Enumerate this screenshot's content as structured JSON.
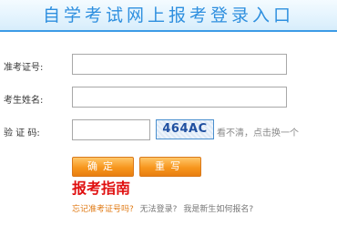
{
  "header": {
    "title": "自学考试网上报考登录入口"
  },
  "form": {
    "id_label": "准考证号:",
    "name_label": "考生姓名:",
    "captcha_label": "验 证 码:",
    "id_value": "",
    "name_value": "",
    "captcha_value": "",
    "captcha_code": "464AC",
    "captcha_hint": "看不清，点击换一个"
  },
  "buttons": {
    "confirm": "确定",
    "fill": "重写"
  },
  "guide": {
    "text": "报考指南"
  },
  "links": {
    "forgot": "忘记准考证号吗?",
    "cannot_login": "无法登录?",
    "new_student": "我是新生如何报名?"
  },
  "colors": {
    "header_text": "#2e8fdf",
    "button": "#f7961d",
    "guide": "#e01010",
    "forgot_link": "#e07b16"
  }
}
